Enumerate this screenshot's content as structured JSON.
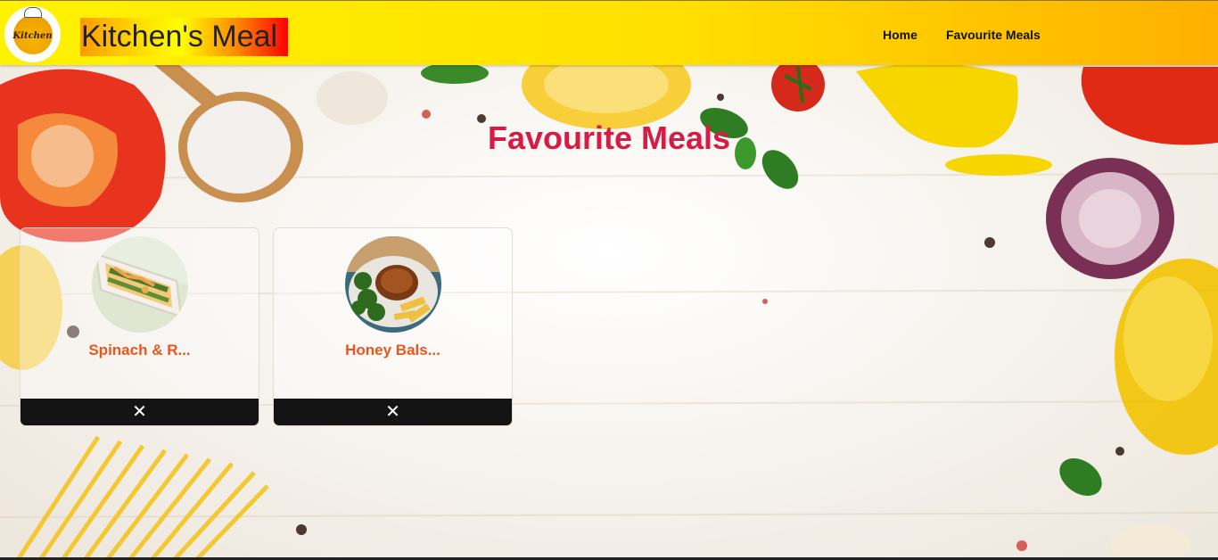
{
  "header": {
    "logo_text": "Kitchen",
    "brand_title": "Kitchen's Meal",
    "nav": [
      {
        "label": "Home"
      },
      {
        "label": "Favourite Meals"
      }
    ]
  },
  "main": {
    "title": "Favourite Meals",
    "meals": [
      {
        "name": "Spinach & R...",
        "remove_label": "✕"
      },
      {
        "name": "Honey Bals...",
        "remove_label": "✕"
      }
    ]
  },
  "colors": {
    "header_start": "#fff200",
    "header_end": "#ffb000",
    "title": "#d81b45",
    "meal_name": "#e8571e",
    "remove_bar": "#141414"
  },
  "icons": {
    "remove": "close-icon"
  }
}
